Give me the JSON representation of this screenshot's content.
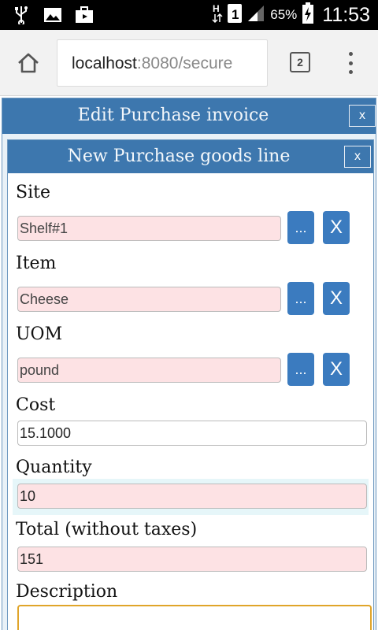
{
  "status_bar": {
    "battery": "65%",
    "time": "11:53",
    "sim_badge": "1",
    "icons": [
      "usb-icon",
      "image-icon",
      "briefcase-icon",
      "data-arrows-icon",
      "signal-icon",
      "battery-charging-icon"
    ]
  },
  "browser": {
    "url_host": "localhost",
    "url_rest": ":8080/secure",
    "tab_count": "2"
  },
  "outer_dialog": {
    "title": "Edit Purchase invoice",
    "close_label": "x"
  },
  "inner_dialog": {
    "title": "New Purchase goods line",
    "close_label": "x",
    "pick_label": "...",
    "clear_label": "X",
    "fields": {
      "site": {
        "label": "Site",
        "value": "Shelf#1"
      },
      "item": {
        "label": "Item",
        "value": "Cheese"
      },
      "uom": {
        "label": "UOM",
        "value": "pound"
      },
      "cost": {
        "label": "Cost",
        "value": "15.1000"
      },
      "quantity": {
        "label": "Quantity",
        "value": "10"
      },
      "total": {
        "label": "Total (without taxes)",
        "value": "151"
      },
      "description": {
        "label": "Description",
        "value": ""
      }
    }
  },
  "colors": {
    "header_blue": "#3d77ae",
    "button_blue": "#3b7bbf",
    "required_pink": "#fde2e4",
    "focus_orange": "#e0a52a"
  }
}
